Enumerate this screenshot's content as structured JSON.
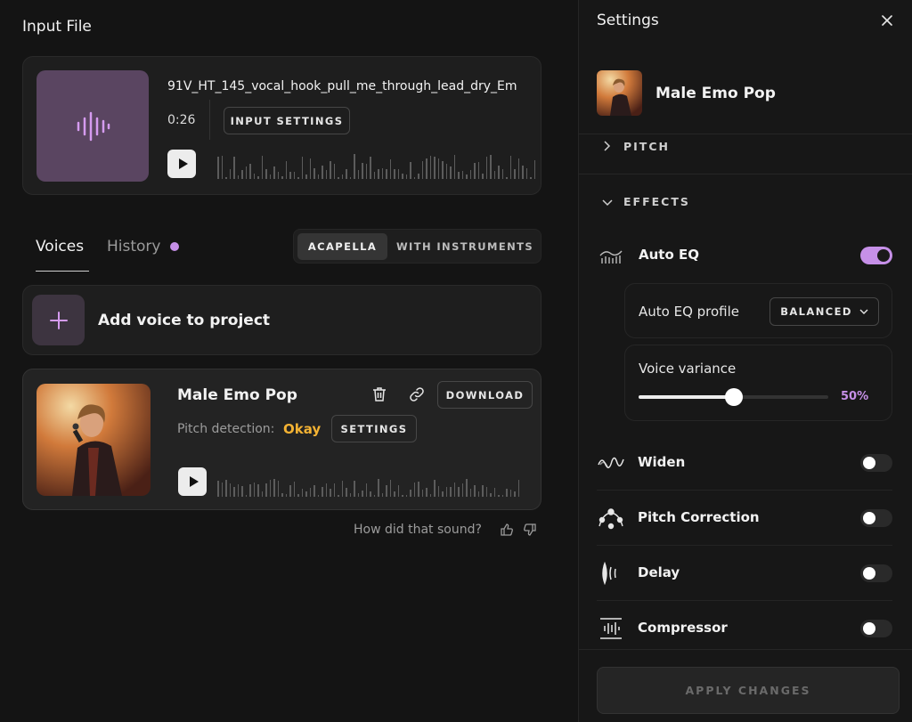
{
  "left": {
    "input_title": "Input File",
    "input_file": {
      "filename": "91V_HT_145_vocal_hook_pull_me_through_lead_dry_Em",
      "duration": "0:26",
      "settings_label": "INPUT SETTINGS"
    },
    "tabs": [
      {
        "label": "Voices",
        "active": true
      },
      {
        "label": "History",
        "active": false,
        "has_badge": true
      }
    ],
    "mode_toggle": {
      "options": [
        "ACAPELLA",
        "WITH INSTRUMENTS"
      ],
      "selected": "ACAPELLA"
    },
    "add_voice_label": "Add voice to project",
    "voice_card": {
      "name": "Male Emo Pop",
      "download_label": "DOWNLOAD",
      "pitch_label": "Pitch detection:",
      "pitch_value": "Okay",
      "settings_label": "SETTINGS"
    },
    "feedback_prompt": "How did that sound?"
  },
  "settings": {
    "title": "Settings",
    "voice_name": "Male Emo Pop",
    "pitch_header": "PITCH",
    "effects_header": "EFFECTS",
    "auto_eq": {
      "label": "Auto EQ",
      "enabled": true
    },
    "eq_profile": {
      "label": "Auto EQ profile",
      "value": "BALANCED"
    },
    "voice_variance": {
      "label": "Voice variance",
      "value": 0.5,
      "display": "50%"
    },
    "effects": [
      {
        "label": "Widen",
        "icon": "widen-icon",
        "enabled": false
      },
      {
        "label": "Pitch Correction",
        "icon": "pitch-correction-icon",
        "enabled": false
      },
      {
        "label": "Delay",
        "icon": "delay-icon",
        "enabled": false
      },
      {
        "label": "Compressor",
        "icon": "compressor-icon",
        "enabled": false
      }
    ],
    "apply_label": "APPLY CHANGES"
  },
  "colors": {
    "accent": "#c690e8",
    "pitch_ok": "#f3b233",
    "input_art": "#5a4561"
  }
}
